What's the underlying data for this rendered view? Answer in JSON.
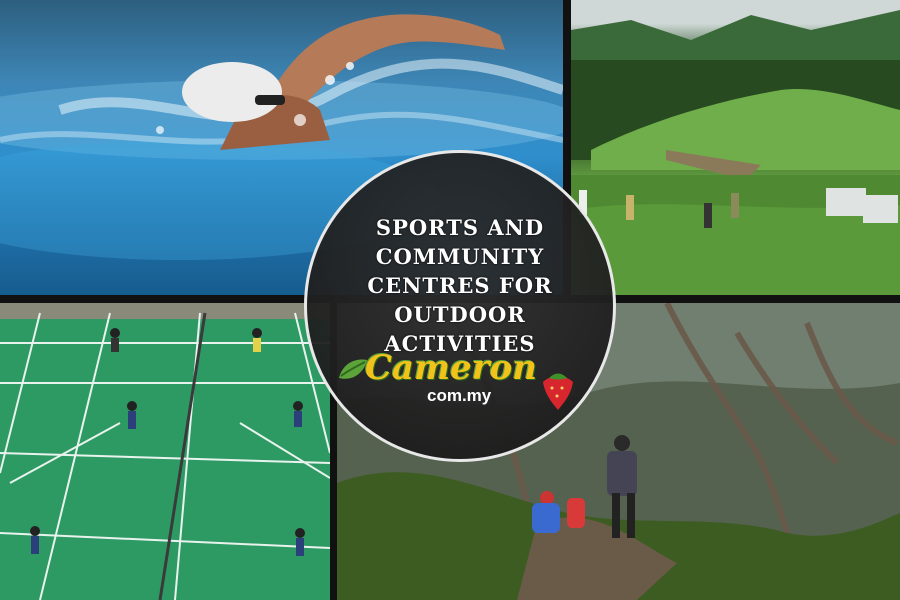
{
  "headline_lines": [
    "SPORTS AND",
    "COMMUNITY",
    "CENTRES FOR",
    "OUTDOOR",
    "ACTIVITIES"
  ],
  "logo": {
    "main": "Cameron",
    "sub": "com.my"
  },
  "tiles": [
    {
      "name": "swimming-photo",
      "subject": "swimmer"
    },
    {
      "name": "golf-photo",
      "subject": "golf course"
    },
    {
      "name": "badminton-photo",
      "subject": "badminton court"
    },
    {
      "name": "trail-photo",
      "subject": "mossy forest trail"
    }
  ],
  "colors": {
    "headline": "#ffffff",
    "logo_gold": "#f3c21a",
    "logo_green": "#3f8f2a",
    "strawberry": "#d8262e"
  }
}
